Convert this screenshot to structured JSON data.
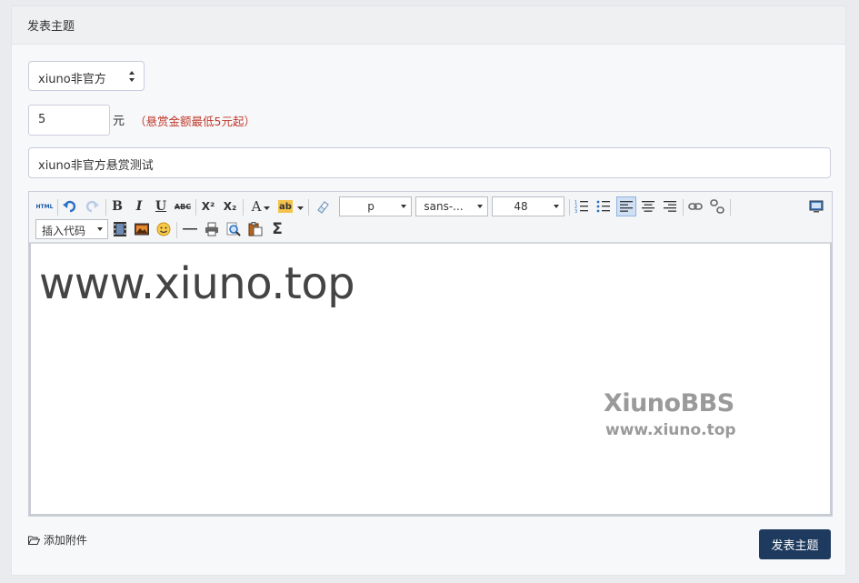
{
  "card": {
    "title": "发表主题"
  },
  "form": {
    "forum_select": {
      "value": "xiuno非官方"
    },
    "reward": {
      "value": "5",
      "unit": "元",
      "note": "（悬赏金额最低5元起）"
    },
    "subject": {
      "value": "xiuno非官方悬赏测试"
    }
  },
  "toolbar": {
    "html_label": "HTML",
    "bold": "B",
    "italic": "I",
    "underline": "U",
    "strike": "ABC",
    "superscript": "X²",
    "subscript": "X₂",
    "font_color": "A",
    "highlight": "ab",
    "format_select": "p",
    "font_family_select": "sans-...",
    "font_size_select": "48",
    "insert_code_select": "插入代码",
    "sigma": "Σ",
    "icons": [
      "html-icon",
      "undo-icon",
      "redo-icon",
      "bold-icon",
      "italic-icon",
      "underline-icon",
      "strikethrough-icon",
      "superscript-icon",
      "subscript-icon",
      "font-color-icon",
      "highlight-icon",
      "eraser-icon",
      "ordered-list-icon",
      "unordered-list-icon",
      "align-left-icon",
      "align-center-icon",
      "align-right-icon",
      "link-icon",
      "unlink-icon",
      "preview-icon",
      "video-icon",
      "image-icon",
      "emoji-icon",
      "horizontal-rule-icon",
      "print-icon",
      "search-icon",
      "paste-icon",
      "formula-icon"
    ]
  },
  "editor": {
    "content": "www.xiuno.top",
    "watermark_logo": "XiunoBBS",
    "watermark_url": "www.xiuno.top"
  },
  "footer": {
    "attach_label": "添加附件",
    "submit_label": "发表主题"
  },
  "colors": {
    "submit_bg": "#1e3a5f",
    "note_red": "#c0392b",
    "active_button": "#cfe0f5"
  }
}
